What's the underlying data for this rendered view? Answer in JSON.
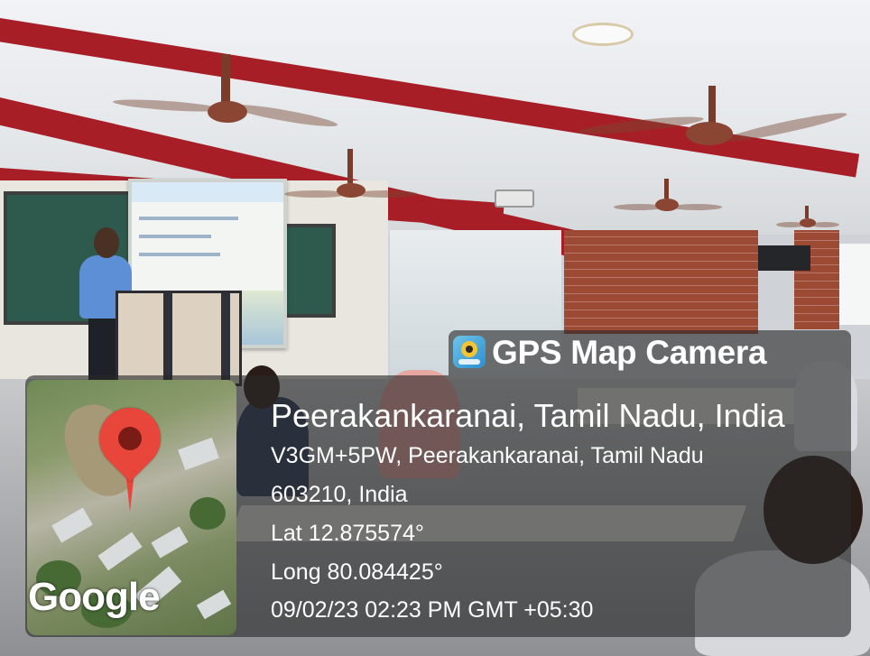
{
  "overlay": {
    "app_name": "GPS Map Camera",
    "app_icon": "gps-map-camera-app-icon",
    "map_logo": "Google",
    "place": "Peerakankaranai, Tamil Nadu, India",
    "address_line1": "V3GM+5PW, Peerakankaranai, Tamil Nadu",
    "address_line2": "603210, India",
    "latitude": "Lat 12.875574°",
    "longitude": "Long 80.084425°",
    "datetime": "09/02/23 02:23 PM GMT +05:30",
    "colors": {
      "overlay_bg": "rgba(40,40,40,0.62)",
      "text": "#ffffff",
      "pin": "#e8453b"
    }
  },
  "scene": {
    "icons": [
      "map-pin-icon",
      "ceiling-fan-icon"
    ]
  }
}
